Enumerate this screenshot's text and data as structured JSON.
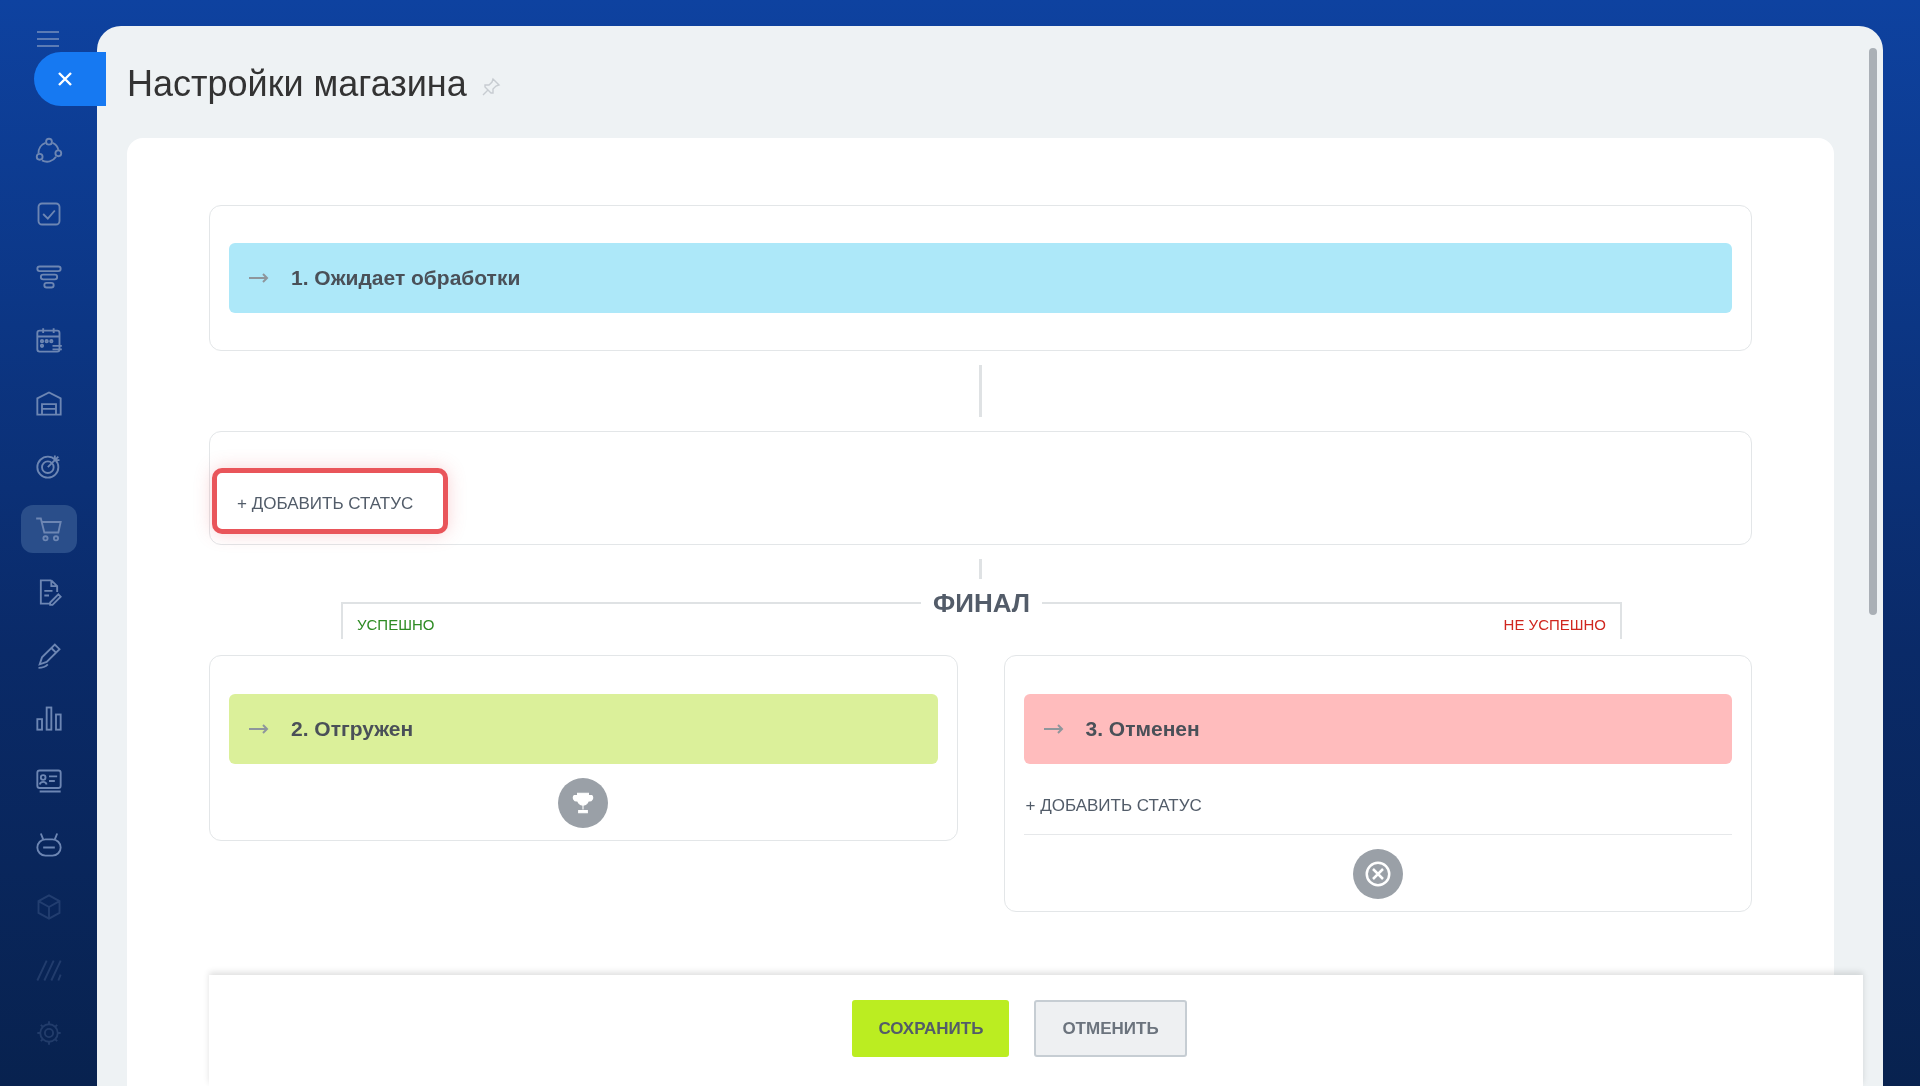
{
  "sidebar": {
    "items": [
      {
        "kind": "nodes",
        "selected": false,
        "dimmed": false
      },
      {
        "kind": "checkbox",
        "selected": false,
        "dimmed": false
      },
      {
        "kind": "funnel",
        "selected": false,
        "dimmed": false
      },
      {
        "kind": "calendar",
        "selected": false,
        "dimmed": false
      },
      {
        "kind": "warehouse",
        "selected": false,
        "dimmed": false
      },
      {
        "kind": "target",
        "selected": false,
        "dimmed": false
      },
      {
        "kind": "cart",
        "selected": true,
        "dimmed": false
      },
      {
        "kind": "document",
        "selected": false,
        "dimmed": false
      },
      {
        "kind": "pen",
        "selected": false,
        "dimmed": false
      },
      {
        "kind": "chart",
        "selected": false,
        "dimmed": false
      },
      {
        "kind": "card",
        "selected": false,
        "dimmed": false
      },
      {
        "kind": "robot",
        "selected": false,
        "dimmed": false
      },
      {
        "kind": "cube",
        "selected": false,
        "dimmed": true
      },
      {
        "kind": "stripes",
        "selected": false,
        "dimmed": true
      },
      {
        "kind": "gear",
        "selected": false,
        "dimmed": true
      }
    ]
  },
  "window": {
    "title": "Настройки магазина"
  },
  "stages": {
    "initial": [
      {
        "name": "1. Ожидает обработки",
        "color": "#ade8f9"
      }
    ],
    "intermediate": {
      "add_button": {
        "label": "+ ДОБАВИТЬ СТАТУС",
        "highlighted": true
      }
    },
    "final": {
      "title": "ФИНАЛ",
      "success": {
        "label": "УСПЕШНО",
        "statuses": [
          {
            "name": "2. Отгружен",
            "color": "#dbf09a"
          }
        ]
      },
      "failure": {
        "label": "НЕ УСПЕШНО",
        "statuses": [
          {
            "name": "3. Отменен",
            "color": "#ffbcbd"
          }
        ],
        "add_button": {
          "label": "+ ДОБАВИТЬ СТАТУС",
          "highlighted": false
        }
      }
    }
  },
  "footer": {
    "buttons": [
      {
        "label": "СОХРАНИТЬ",
        "kind": "primary"
      },
      {
        "label": "ОТМЕНИТЬ",
        "kind": "secondary"
      }
    ]
  }
}
